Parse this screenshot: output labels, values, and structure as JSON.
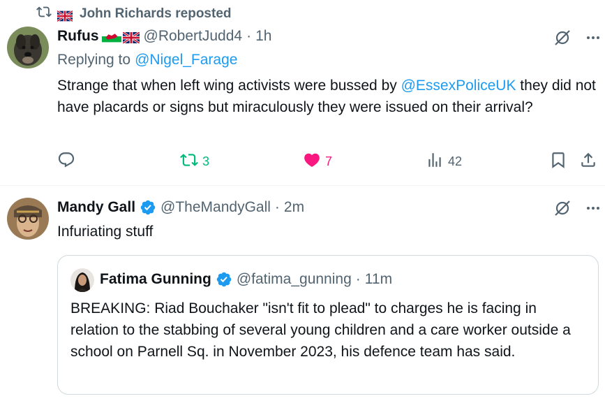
{
  "repost": {
    "label": "John Richards reposted"
  },
  "tweet1": {
    "author_name": "Rufus",
    "handle": "@RobertJudd4",
    "separator": "·",
    "time": "1h",
    "replying_prefix": "Replying to ",
    "replying_to": "@Nigel_Farage",
    "text_before": "Strange that when left wing activists were bussed by ",
    "text_mention": "@EssexPoliceUK",
    "text_after": " they did not have placards or signs but miraculously they were issued on their arrival?",
    "reposts": "3",
    "likes": "7",
    "views": "42"
  },
  "tweet2": {
    "author_name": "Mandy Gall",
    "handle": "@TheMandyGall",
    "separator": "·",
    "time": "2m",
    "text": "Infuriating stuff"
  },
  "quote": {
    "author_name": "Fatima Gunning",
    "handle": "@fatima_gunning",
    "separator": "·",
    "time": "11m",
    "text": "BREAKING: Riad Bouchaker \"isn't fit to plead\" to charges he is facing in relation to the stabbing of several young children and a care worker outside a school on Parnell Sq. in November 2023, his defence team has said."
  },
  "colors": {
    "accent": "#1d9bf0",
    "muted": "#536471",
    "repost_green": "#00ba7c",
    "like_pink": "#f91880",
    "border": "#cfd9de"
  },
  "icons": [
    "repost-icon",
    "flag-uk-icon",
    "flag-wales-icon",
    "grok-icon",
    "more-icon",
    "reply-icon",
    "like-icon",
    "views-icon",
    "bookmark-icon",
    "share-icon",
    "verified-icon"
  ]
}
